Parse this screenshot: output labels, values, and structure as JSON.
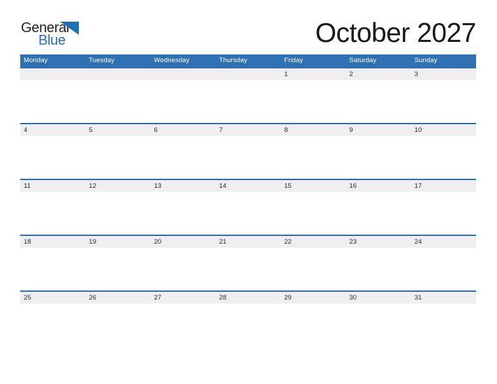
{
  "logo": {
    "word_top": "General",
    "word_bottom": "Blue",
    "flag_icon": "blue-triangle-flag-icon",
    "color_text": "#231f20",
    "color_blue": "#2071b8"
  },
  "header": {
    "title": "October 2027",
    "month": "October",
    "year": "2027"
  },
  "theme": {
    "header_blue": "#2e70b2",
    "date_band_gray": "#efefef",
    "date_text": "#2b2b2b",
    "page_background": "#ffffff"
  },
  "calendar": {
    "week_start": "Monday",
    "weekdays": [
      "Monday",
      "Tuesday",
      "Wednesday",
      "Thursday",
      "Friday",
      "Saturday",
      "Sunday"
    ],
    "weeks": [
      [
        "",
        "",
        "",
        "",
        "1",
        "2",
        "3"
      ],
      [
        "4",
        "5",
        "6",
        "7",
        "8",
        "9",
        "10"
      ],
      [
        "11",
        "12",
        "13",
        "14",
        "15",
        "16",
        "17"
      ],
      [
        "18",
        "19",
        "20",
        "21",
        "22",
        "23",
        "24"
      ],
      [
        "25",
        "26",
        "27",
        "28",
        "29",
        "30",
        "31"
      ]
    ]
  }
}
